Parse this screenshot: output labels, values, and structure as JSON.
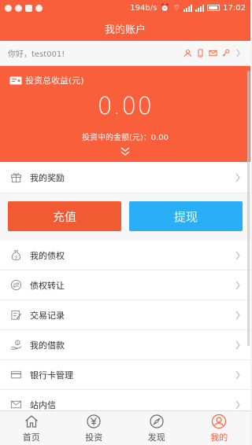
{
  "status_bar": {
    "net_speed": "194b/s",
    "time": "17:02"
  },
  "header": {
    "title": "我的账户"
  },
  "greeting": {
    "text": "你好，test001!"
  },
  "summary": {
    "title": "投资总收益(元)",
    "total_income": "0.00",
    "investing_amount": "投资中的金额(元)：0.00"
  },
  "rewards": {
    "label": "我的奖励"
  },
  "actions": {
    "recharge_label": "充值",
    "withdraw_label": "提现"
  },
  "menu": [
    {
      "label": "我的债权"
    },
    {
      "label": "债权转让"
    },
    {
      "label": "交易记录"
    },
    {
      "label": "我的借款"
    },
    {
      "label": "银行卡管理"
    },
    {
      "label": "站内信"
    }
  ],
  "tabs": [
    {
      "label": "首页"
    },
    {
      "label": "投资"
    },
    {
      "label": "发现"
    },
    {
      "label": "我的"
    }
  ],
  "colors": {
    "brand": "#fa5f3c",
    "withdraw": "#2aaef5",
    "recharge": "#f25a34"
  }
}
